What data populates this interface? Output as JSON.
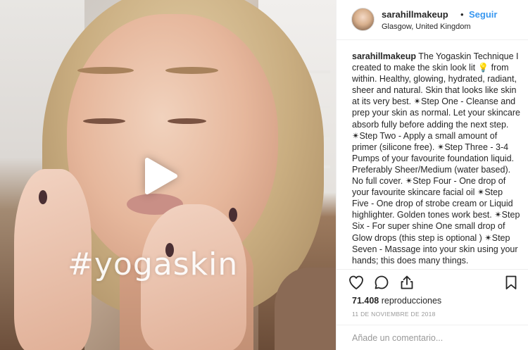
{
  "video": {
    "hashtag_overlay": "#yogaskin"
  },
  "post": {
    "username": "sarahillmakeup",
    "separator": "•",
    "follow_label": "Seguir",
    "location": "Glasgow, United Kingdom",
    "caption_username": "sarahillmakeup",
    "caption_text": " The Yogaskin Technique I created to make the skin look lit 💡 from within. Healthy, glowing, hydrated, radiant, sheer and natural. Skin that looks like skin at its very best. ✴Step One - Cleanse and prep your skin as normal. Let your skincare absorb fully before adding the next step. ✴Step Two - Apply a small amount of primer (silicone free). ✴Step Three - 3-4 Pumps of your favourite foundation liquid. Preferably Sheer/Medium (water based). No full cover. ✴Step Four - One drop of your favourite skincare facial oil ✴Step Five - One drop of strobe cream or Liquid highlighter. Golden tones work best. ✴Step Six - For super shine One small drop of Glow drops (this step is optional ) ✴Step Seven - Massage into your skin using your hands; this does many things.",
    "views_count": "71.408",
    "views_label": " reproducciones",
    "date": "11 DE NOVIEMBRE DE 2018",
    "comment_placeholder": "Añade un comentario..."
  },
  "icons": {
    "play": "play-icon",
    "like": "heart-icon",
    "comment": "comment-icon",
    "share": "share-icon",
    "save": "bookmark-icon"
  },
  "colors": {
    "accent": "#3897f0",
    "text": "#262626",
    "muted": "#999999",
    "border": "#efefef"
  }
}
